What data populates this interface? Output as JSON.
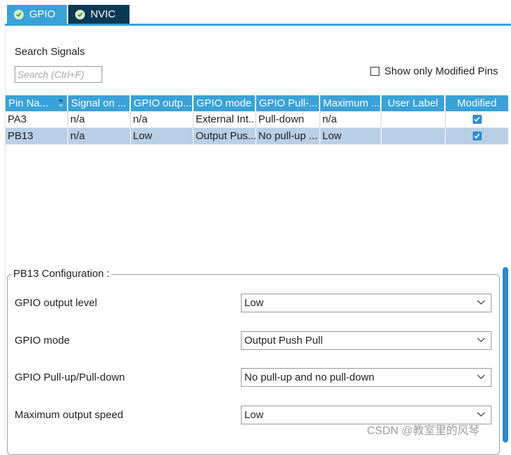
{
  "tabs": [
    {
      "label": "GPIO",
      "active": true
    },
    {
      "label": "NVIC",
      "active": false
    }
  ],
  "search": {
    "label": "Search Signals",
    "placeholder": "Search (Ctrl+F)",
    "value": ""
  },
  "show_modified": {
    "label": "Show only Modified Pins",
    "checked": false
  },
  "table": {
    "columns": [
      "Pin Na...",
      "Signal on ...",
      "GPIO outp...",
      "GPIO mode",
      "GPIO Pull-...",
      "Maximum ...",
      "User Label",
      "Modified"
    ],
    "rows": [
      {
        "pin": "PA3",
        "signal": "n/a",
        "output": "n/a",
        "mode": "External Int...",
        "pull": "Pull-down",
        "speed": "n/a",
        "label": "",
        "modified": true,
        "selected": false
      },
      {
        "pin": "PB13",
        "signal": "n/a",
        "output": "Low",
        "mode": "Output Pus...",
        "pull": "No pull-up ...",
        "speed": "Low",
        "label": "",
        "modified": true,
        "selected": true
      }
    ]
  },
  "config": {
    "title": "PB13 Configuration :",
    "fields": [
      {
        "label": "GPIO output level",
        "value": "Low"
      },
      {
        "label": "GPIO mode",
        "value": "Output Push Pull"
      },
      {
        "label": "GPIO Pull-up/Pull-down",
        "value": "No pull-up and no pull-down"
      },
      {
        "label": "Maximum output speed",
        "value": "Low"
      }
    ]
  },
  "watermark": "CSDN @教室里的风琴",
  "colors": {
    "accent": "#3aa2d8",
    "tab_dark": "#0b3954",
    "selected_row": "#b9cfe6"
  }
}
